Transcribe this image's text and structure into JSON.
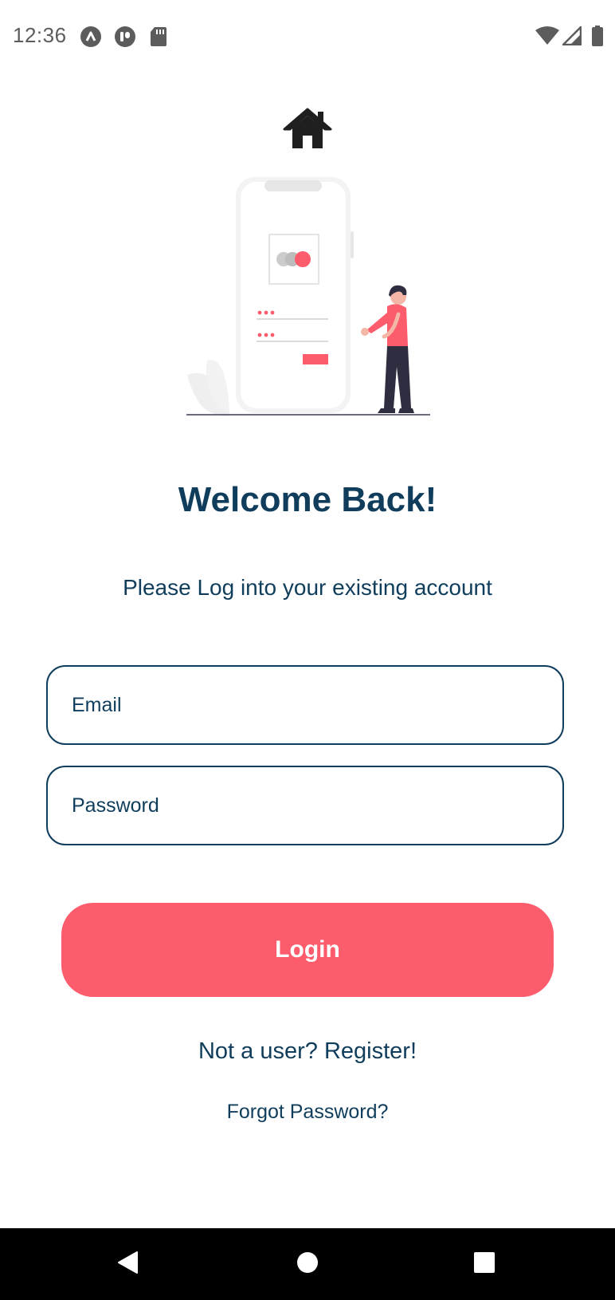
{
  "status_bar": {
    "time": "12:36",
    "left_icons": [
      "app-a-icon",
      "app-p-icon",
      "sd-card-icon"
    ],
    "right_icons": [
      "wifi-icon",
      "cell-signal-icon",
      "battery-icon"
    ]
  },
  "header": {
    "icon": "home-icon",
    "illustration": "phone-login-illustration"
  },
  "main": {
    "title": "Welcome Back!",
    "subtitle": "Please Log into your existing account",
    "email_placeholder": "Email",
    "password_placeholder": "Password",
    "login_label": "Login",
    "register_text": "Not a user? Register!",
    "forgot_text": "Forgot Password?"
  },
  "nav_bar": {
    "icons": [
      "back-icon",
      "home-circle-icon",
      "recents-icon"
    ]
  },
  "colors": {
    "primary_text": "#0f3d5b",
    "accent": "#fc5c6b",
    "background": "#ffffff"
  }
}
